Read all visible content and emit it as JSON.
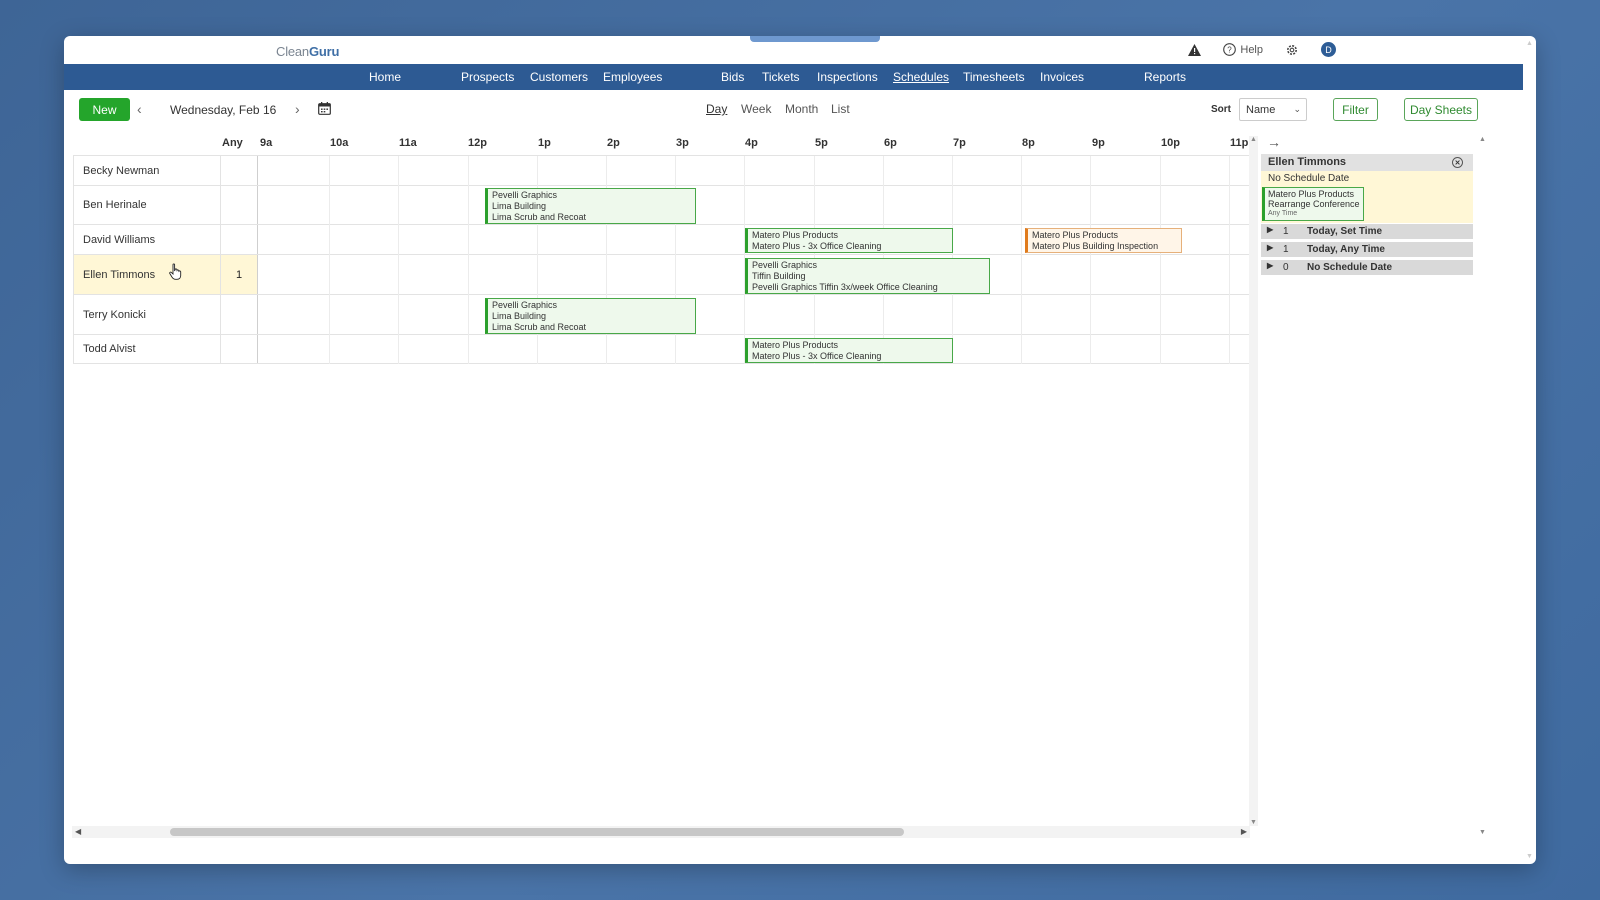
{
  "app": {
    "logo_light": "Clean",
    "logo_bold": "Guru"
  },
  "top": {
    "help_label": "Help",
    "avatar_initial": "D"
  },
  "nav": [
    {
      "label": "Home"
    },
    {
      "label": "Prospects"
    },
    {
      "label": "Customers"
    },
    {
      "label": "Employees"
    },
    {
      "label": "Bids"
    },
    {
      "label": "Tickets"
    },
    {
      "label": "Inspections"
    },
    {
      "label": "Schedules"
    },
    {
      "label": "Timesheets"
    },
    {
      "label": "Invoices"
    },
    {
      "label": "Reports"
    }
  ],
  "toolbar": {
    "new_label": "New",
    "date": "Wednesday, Feb 16",
    "views": [
      "Day",
      "Week",
      "Month",
      "List"
    ],
    "sort_label": "Sort",
    "sort_value": "Name",
    "filter_label": "Filter",
    "daysheets_label": "Day Sheets"
  },
  "columns": {
    "any": "Any",
    "hours": [
      "9a",
      "10a",
      "11a",
      "12p",
      "1p",
      "2p",
      "3p",
      "4p",
      "5p",
      "6p",
      "7p",
      "8p",
      "9p",
      "10p",
      "11p"
    ]
  },
  "employees": [
    {
      "name": "Becky Newman",
      "any": ""
    },
    {
      "name": "Ben Herinale",
      "any": ""
    },
    {
      "name": "David Williams",
      "any": ""
    },
    {
      "name": "Ellen Timmons",
      "any": "1"
    },
    {
      "name": "Terry Konicki",
      "any": ""
    },
    {
      "name": "Todd Alvist",
      "any": ""
    }
  ],
  "events": [
    {
      "lines": [
        "Pevelli Graphics",
        "Lima Building",
        "Lima Scrub and Recoat"
      ]
    },
    {
      "lines": [
        "Matero Plus Products",
        "Matero Plus - 3x Office Cleaning"
      ]
    },
    {
      "lines": [
        "Matero Plus Products",
        "Matero Plus Building Inspection"
      ]
    },
    {
      "lines": [
        "Pevelli Graphics",
        "Tiffin Building",
        "Pevelli Graphics Tiffin 3x/week Office Cleaning"
      ]
    },
    {
      "lines": [
        "Pevelli Graphics",
        "Lima Building",
        "Lima Scrub and Recoat"
      ]
    },
    {
      "lines": [
        "Matero Plus Products",
        "Matero Plus - 3x Office Cleaning"
      ]
    }
  ],
  "panel": {
    "title": "Ellen Timmons",
    "subtitle": "No Schedule Date",
    "card_lines": [
      "Matero Plus Products",
      "Rearrange Conference"
    ],
    "card_time": "Any Time",
    "groups": [
      {
        "count": "1",
        "label": "Today, Set Time"
      },
      {
        "count": "1",
        "label": "Today, Any Time"
      },
      {
        "count": "0",
        "label": "No Schedule Date"
      }
    ]
  }
}
